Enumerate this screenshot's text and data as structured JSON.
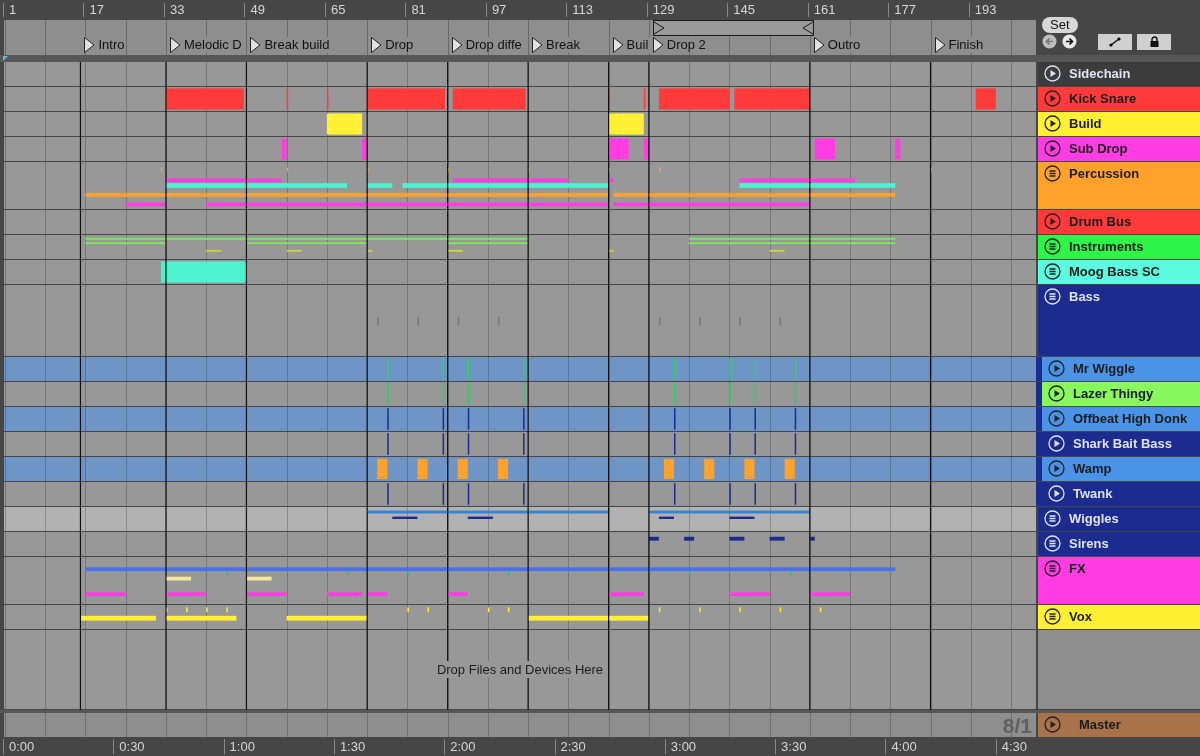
{
  "ruler": {
    "bars": [
      "1",
      "17",
      "33",
      "49",
      "65",
      "81",
      "97",
      "113",
      "129",
      "145",
      "161",
      "177",
      "193"
    ]
  },
  "locators": [
    {
      "label": "Intro"
    },
    {
      "label": "Melodic D"
    },
    {
      "label": "Break build"
    },
    {
      "label": "Drop"
    },
    {
      "label": "Drop diffe"
    },
    {
      "label": "Break"
    },
    {
      "label": "Buil"
    },
    {
      "label": "Drop 2"
    },
    {
      "label": "Outro"
    },
    {
      "label": "Finish"
    }
  ],
  "controls": {
    "set": "Set"
  },
  "tracks": [
    {
      "name": "Sidechain",
      "kind": "track",
      "color": "#3c3c3c",
      "tall": false
    },
    {
      "name": "Kick Snare",
      "kind": "track",
      "color": "#ff3a3a",
      "tall": false
    },
    {
      "name": "Build",
      "kind": "track",
      "color": "#fff034",
      "tall": false
    },
    {
      "name": "Sub Drop",
      "kind": "track",
      "color": "#ff3de2",
      "tall": false
    },
    {
      "name": "Percussion",
      "kind": "group",
      "color": "#ffa22c",
      "tall": true
    },
    {
      "name": "Drum Bus",
      "kind": "track",
      "color": "#ff3a3a",
      "tall": false
    },
    {
      "name": "Instruments",
      "kind": "group",
      "color": "#2ff548",
      "tall": false
    },
    {
      "name": "Moog Bass SC",
      "kind": "group",
      "color": "#5cfbe0",
      "tall": false
    },
    {
      "name": "Bass",
      "kind": "group",
      "color": "#1b2c8e",
      "tall": true,
      "children": [
        {
          "name": "Mr Wiggle",
          "kind": "track",
          "color": "#4a93e6",
          "tall": false
        },
        {
          "name": "Lazer Thingy",
          "kind": "track",
          "color": "#88f85e",
          "tall": false
        },
        {
          "name": "Offbeat High Donk",
          "kind": "track",
          "color": "#4a93e6",
          "tall": false
        },
        {
          "name": "Shark Bait Bass",
          "kind": "track",
          "color": "#1b2c8e",
          "tall": false
        },
        {
          "name": "Wamp",
          "kind": "track",
          "color": "#4a93e6",
          "tall": false
        },
        {
          "name": "Twank",
          "kind": "track",
          "color": "#1b2c8e",
          "tall": false
        }
      ]
    },
    {
      "name": "Wiggles",
      "kind": "group",
      "color": "#1b2c8e",
      "tall": false
    },
    {
      "name": "Sirens",
      "kind": "group",
      "color": "#1b2c8e",
      "tall": false
    },
    {
      "name": "FX",
      "kind": "group",
      "color": "#ff3de2",
      "tall": true
    },
    {
      "name": "Vox",
      "kind": "group",
      "color": "#fff034",
      "tall": false
    }
  ],
  "drop_hint": "Drop Files and Devices Here",
  "zoom_readout": "8/1",
  "master": {
    "name": "Master",
    "kind": "track",
    "color": "#a8734a"
  },
  "time_ruler": [
    "0:00",
    "0:30",
    "1:00",
    "1:30",
    "2:00",
    "2:30",
    "3:00",
    "3:30",
    "4:00",
    "4:30"
  ]
}
